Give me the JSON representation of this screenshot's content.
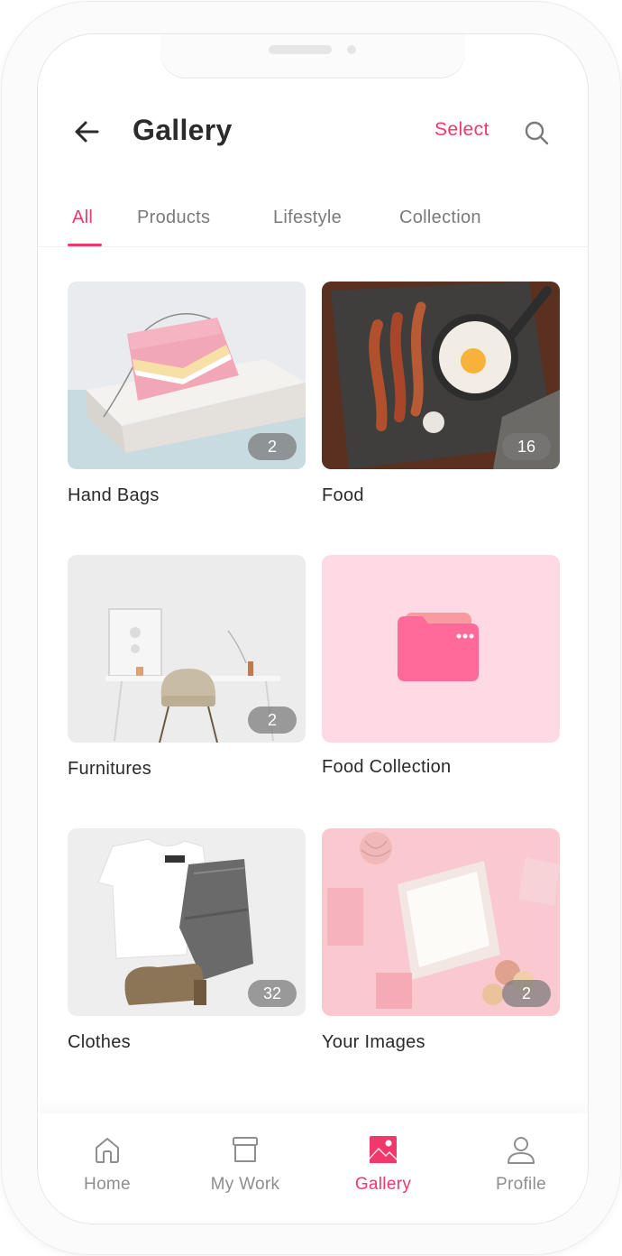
{
  "header": {
    "title": "Gallery",
    "select_label": "Select"
  },
  "tabs": [
    {
      "label": "All",
      "active": true
    },
    {
      "label": "Products",
      "active": false
    },
    {
      "label": "Lifestyle",
      "active": false
    },
    {
      "label": "Collection",
      "active": false
    }
  ],
  "albums": [
    {
      "name": "Hand Bags",
      "count": "2"
    },
    {
      "name": "Food",
      "count": "16"
    },
    {
      "name": "Furnitures",
      "count": "2"
    },
    {
      "name": "Food Collection",
      "count": ""
    },
    {
      "name": "Clothes",
      "count": "32"
    },
    {
      "name": "Your Images",
      "count": "2"
    }
  ],
  "bottom_nav": [
    {
      "label": "Home",
      "icon": "home-icon",
      "active": false
    },
    {
      "label": "My Work",
      "icon": "archive-icon",
      "active": false
    },
    {
      "label": "Gallery",
      "icon": "image-icon",
      "active": true
    },
    {
      "label": "Profile",
      "icon": "user-icon",
      "active": false
    }
  ],
  "colors": {
    "accent": "#f0386b",
    "text_dark": "#2b2b2b",
    "text_muted": "#7a7a7a"
  }
}
